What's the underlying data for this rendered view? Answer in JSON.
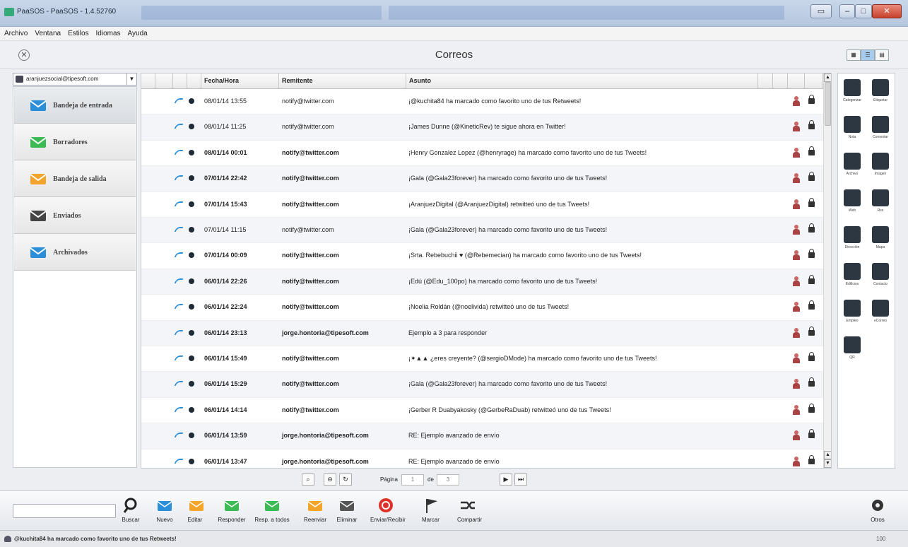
{
  "window": {
    "title": "PaaSOS - PaaSOS - 1.4.52760"
  },
  "menu": [
    "Archivo",
    "Ventana",
    "Estilos",
    "Idiomas",
    "Ayuda"
  ],
  "header": {
    "title": "Correos"
  },
  "account": {
    "email": "aranjuezsocial@tipesoft.com"
  },
  "folders": [
    {
      "label": "Bandeja de entrada",
      "icon": "inbox-icon",
      "color": "#2a8fd8"
    },
    {
      "label": "Borradores",
      "icon": "drafts-icon",
      "color": "#3cba54"
    },
    {
      "label": "Bandeja de salida",
      "icon": "outbox-icon",
      "color": "#f3a52b"
    },
    {
      "label": "Enviados",
      "icon": "sent-icon",
      "color": "#444444"
    },
    {
      "label": "Archivados",
      "icon": "archive-icon",
      "color": "#2a8fd8"
    }
  ],
  "grid": {
    "headers": {
      "date": "Fecha/Hora",
      "from": "Remitente",
      "subject": "Asunto"
    },
    "rows": [
      {
        "date": "08/01/14 13:55",
        "from": "notify@twitter.com",
        "subject": "¡@kuchita84 ha marcado como favorito uno de tus Retweets!",
        "bold": false
      },
      {
        "date": "08/01/14 11:25",
        "from": "notify@twitter.com",
        "subject": "¡James Dunne (@KineticRev) te sigue ahora en Twitter!",
        "bold": false
      },
      {
        "date": "08/01/14 00:01",
        "from": "notify@twitter.com",
        "subject": "¡Henry Gonzalez Lopez (@henryrage) ha marcado como favorito uno de tus Tweets!",
        "bold": true
      },
      {
        "date": "07/01/14 22:42",
        "from": "notify@twitter.com",
        "subject": "¡Gala (@Gala23forever) ha marcado como favorito uno de tus Tweets!",
        "bold": true
      },
      {
        "date": "07/01/14 15:43",
        "from": "notify@twitter.com",
        "subject": "¡AranjuezDigital (@AranjuezDigital) retwitteó uno de tus Tweets!",
        "bold": true
      },
      {
        "date": "07/01/14 11:15",
        "from": "notify@twitter.com",
        "subject": "¡Gala (@Gala23forever) ha marcado como favorito uno de tus Tweets!",
        "bold": false
      },
      {
        "date": "07/01/14 00:09",
        "from": "notify@twitter.com",
        "subject": "¡Srta. Rebebuchii ♥ (@Rebemecian) ha marcado como favorito uno de tus Tweets!",
        "bold": true
      },
      {
        "date": "06/01/14 22:26",
        "from": "notify@twitter.com",
        "subject": "¡Edú (@Edu_100po) ha marcado como favorito uno de tus Tweets!",
        "bold": true
      },
      {
        "date": "06/01/14 22:24",
        "from": "notify@twitter.com",
        "subject": "¡Noelia Roldán (@noelivida) retwitteó uno de tus Tweets!",
        "bold": true
      },
      {
        "date": "06/01/14 23:13",
        "from": "jorge.hontoria@tipesoft.com",
        "subject": "Ejemplo a 3 para responder",
        "bold": true
      },
      {
        "date": "06/01/14 15:49",
        "from": "notify@twitter.com",
        "subject": "¡✦▲▲ ¿eres creyente? (@sergioDMode) ha marcado como favorito uno de tus Tweets!",
        "bold": true
      },
      {
        "date": "06/01/14 15:29",
        "from": "notify@twitter.com",
        "subject": "¡Gala (@Gala23forever) ha marcado como favorito uno de tus Tweets!",
        "bold": true
      },
      {
        "date": "06/01/14 14:14",
        "from": "notify@twitter.com",
        "subject": "¡Gerber R Duabyakosky (@GerbeRaDuab) retwitteó uno de tus Tweets!",
        "bold": true
      },
      {
        "date": "06/01/14 13:59",
        "from": "jorge.hontoria@tipesoft.com",
        "subject": "RE: Ejemplo avanzado de envío",
        "bold": true
      },
      {
        "date": "06/01/14 13:47",
        "from": "jorge.hontoria@tipesoft.com",
        "subject": "RE: Ejemplo avanzado de envío",
        "bold": true
      }
    ]
  },
  "tools": [
    {
      "label": "Categorizar",
      "icon": "categorize-icon"
    },
    {
      "label": "Etiquetar",
      "icon": "tag-icon"
    },
    {
      "label": "Nota",
      "icon": "note-icon"
    },
    {
      "label": "Comentar",
      "icon": "comment-icon"
    },
    {
      "label": "Archivo",
      "icon": "attachment-icon"
    },
    {
      "label": "Imagen",
      "icon": "image-icon"
    },
    {
      "label": "Web",
      "icon": "web-icon"
    },
    {
      "label": "Rss",
      "icon": "rss-icon"
    },
    {
      "label": "Dirección",
      "icon": "address-icon"
    },
    {
      "label": "Mapa",
      "icon": "map-icon"
    },
    {
      "label": "Edificios",
      "icon": "building-icon"
    },
    {
      "label": "Contacto",
      "icon": "contact-icon"
    },
    {
      "label": "Empleo",
      "icon": "job-icon"
    },
    {
      "label": "eCorreo",
      "icon": "email-icon"
    },
    {
      "label": "QR",
      "icon": "qr-icon"
    }
  ],
  "pager": {
    "label": "Página",
    "current": "1",
    "of_label": "de",
    "total": "3"
  },
  "toolbar": [
    {
      "label": "Buscar",
      "icon": "search-icon",
      "color": "#222222"
    },
    {
      "label": "Nuevo",
      "icon": "new-mail-icon",
      "color": "#2a8fd8"
    },
    {
      "label": "Editar",
      "icon": "edit-icon",
      "color": "#f3a52b"
    },
    {
      "label": "Responder",
      "icon": "reply-icon",
      "color": "#3cba54"
    },
    {
      "label": "Resp. a todos",
      "icon": "reply-all-icon",
      "color": "#3cba54"
    },
    {
      "label": "Reenviar",
      "icon": "forward-icon",
      "color": "#f3a52b"
    },
    {
      "label": "Eliminar",
      "icon": "delete-icon",
      "color": "#555555"
    },
    {
      "label": "Enviar/Recibir",
      "icon": "send-receive-icon",
      "color": "#e0302a"
    },
    {
      "label": "Marcar",
      "icon": "flag-icon",
      "color": "#333333"
    },
    {
      "label": "Compartir",
      "icon": "share-icon",
      "color": "#333333"
    },
    {
      "label": "Otros",
      "icon": "gear-icon",
      "color": "#333333"
    }
  ],
  "status": {
    "text": "@kuchita84 ha marcado como favorito uno de tus Retweets!",
    "right": "100"
  }
}
